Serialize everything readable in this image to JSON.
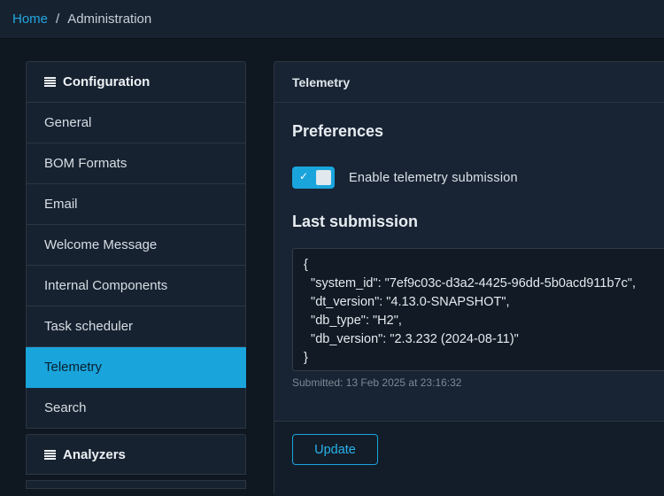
{
  "breadcrumb": {
    "home": "Home",
    "separator": "/",
    "current": "Administration"
  },
  "sidebar": {
    "configuration_title": "Configuration",
    "items": [
      {
        "label": "General",
        "active": false
      },
      {
        "label": "BOM Formats",
        "active": false
      },
      {
        "label": "Email",
        "active": false
      },
      {
        "label": "Welcome Message",
        "active": false
      },
      {
        "label": "Internal Components",
        "active": false
      },
      {
        "label": "Task scheduler",
        "active": false
      },
      {
        "label": "Telemetry",
        "active": true
      },
      {
        "label": "Search",
        "active": false
      }
    ],
    "analyzers_title": "Analyzers"
  },
  "telemetry": {
    "card_title": "Telemetry",
    "preferences_title": "Preferences",
    "toggle_label": "Enable telemetry submission",
    "toggle_on": true,
    "toggle_check": "✓",
    "last_submission_title": "Last submission",
    "payload": "{\n  \"system_id\": \"7ef9c03c-d3a2-4425-96dd-5b0acd911b7c\",\n  \"dt_version\": \"4.13.0-SNAPSHOT\",\n  \"db_type\": \"H2\",\n  \"db_version\": \"2.3.232 (2024-08-11)\"\n}",
    "submitted": "Submitted: 13 Feb 2025 at 23:16:32",
    "update_label": "Update"
  },
  "colors": {
    "accent": "#1aa4dc",
    "background": "#0f1720",
    "panel": "#172231"
  }
}
